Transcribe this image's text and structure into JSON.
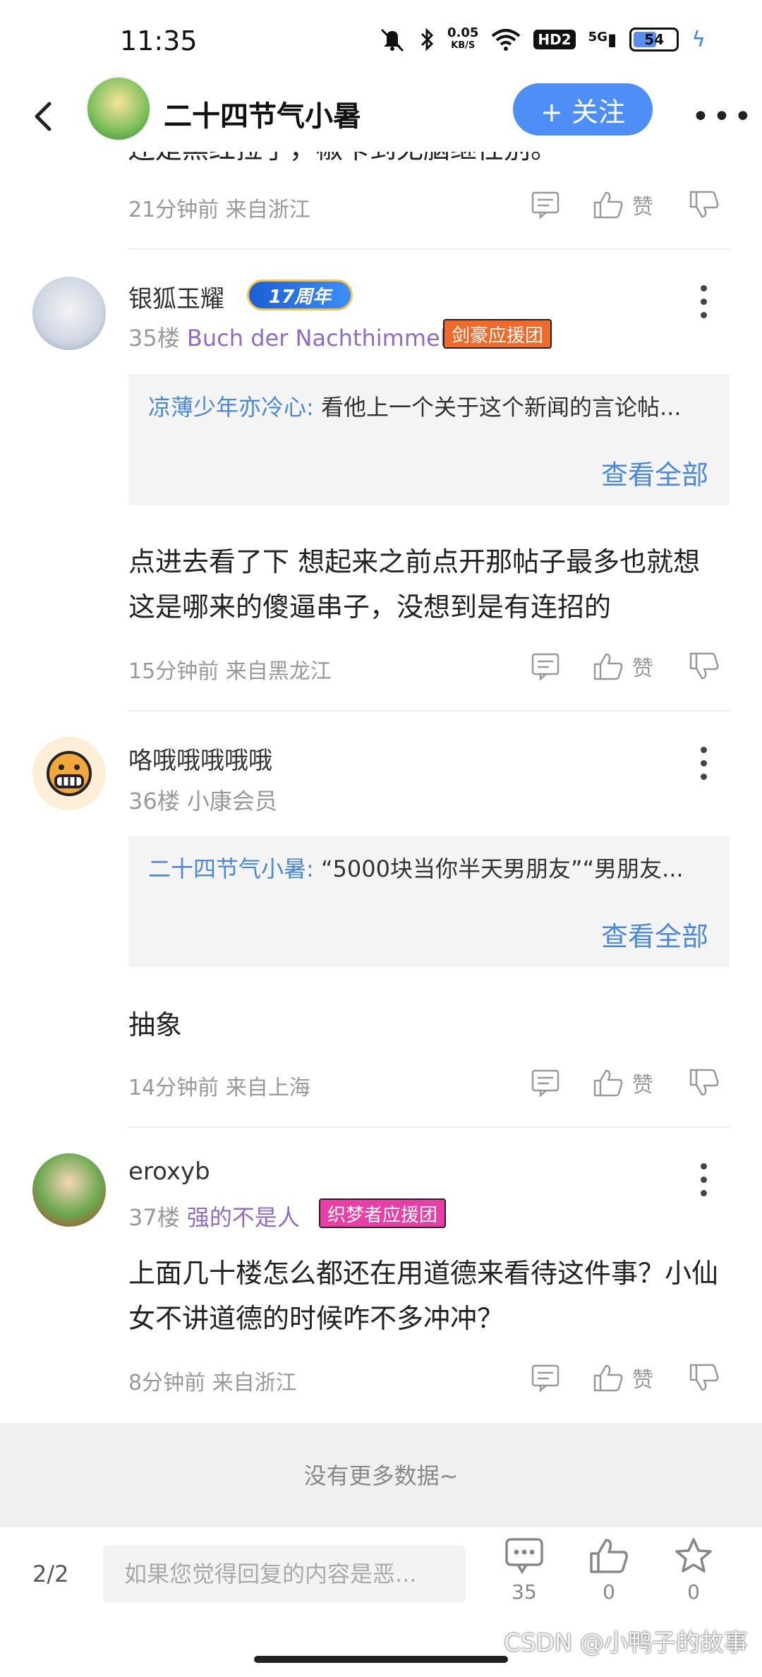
{
  "status": {
    "time": "11:35",
    "net_speed_value": "0.05",
    "net_speed_unit": "KB/S",
    "hd": "HD2",
    "signal": "5G",
    "battery": "54",
    "battery_level_percent": 54
  },
  "header": {
    "title": "二十四节气小暑",
    "follow_label": "+ 关注",
    "more": "•••"
  },
  "cut_text": "还是黑红拉了，椒卡到无脑继性别。",
  "comments": [
    {
      "time": "21分钟前",
      "location": "来自浙江",
      "like_label": "赞"
    },
    {
      "username": "银狐玉耀",
      "badge": "17周年",
      "floor": "35楼",
      "tag": "Buch der Nachthimmel",
      "team_badge": "剑豪应援团",
      "quote_name": "凉薄少年亦冷心:",
      "quote_text": "看他上一个关于这个新闻的言论帖...",
      "quote_more": "查看全部",
      "content": "点进去看了下  想起来之前点开那帖子最多也就想这是哪来的傻逼串子，没想到是有连招的",
      "time": "15分钟前",
      "location": "来自黑龙江",
      "like_label": "赞"
    },
    {
      "username": "咯哦哦哦哦哦",
      "floor": "36楼",
      "tag": "小康会员",
      "quote_name": "二十四节气小暑:",
      "quote_text": "“5000块当你半天男朋友”“男朋友...",
      "quote_more": "查看全部",
      "content": "抽象",
      "time": "14分钟前",
      "location": "来自上海",
      "like_label": "赞"
    },
    {
      "username": "eroxyb",
      "floor": "37楼",
      "tag": "强的不是人",
      "team_badge": "织梦者应援团",
      "content": "上面几十楼怎么都还在用道德来看待这件事？小仙女不讲道德的时候咋不多冲冲？",
      "time": "8分钟前",
      "location": "来自浙江",
      "like_label": "赞"
    }
  ],
  "no_more": "没有更多数据~",
  "bottom": {
    "page": "2/2",
    "reply_placeholder": "如果您觉得回复的内容是恶...",
    "comments_count": "35",
    "likes_count": "0",
    "favorites_count": "0",
    "watermark": "CSDN @小鸭子的故事"
  },
  "colors": {
    "accent_blue": "#4e8ef7",
    "link_blue": "#4a88d9",
    "tag_purple": "#8e6cc7",
    "team_orange": "#f06a2a",
    "team_pink": "#e83fa6"
  }
}
